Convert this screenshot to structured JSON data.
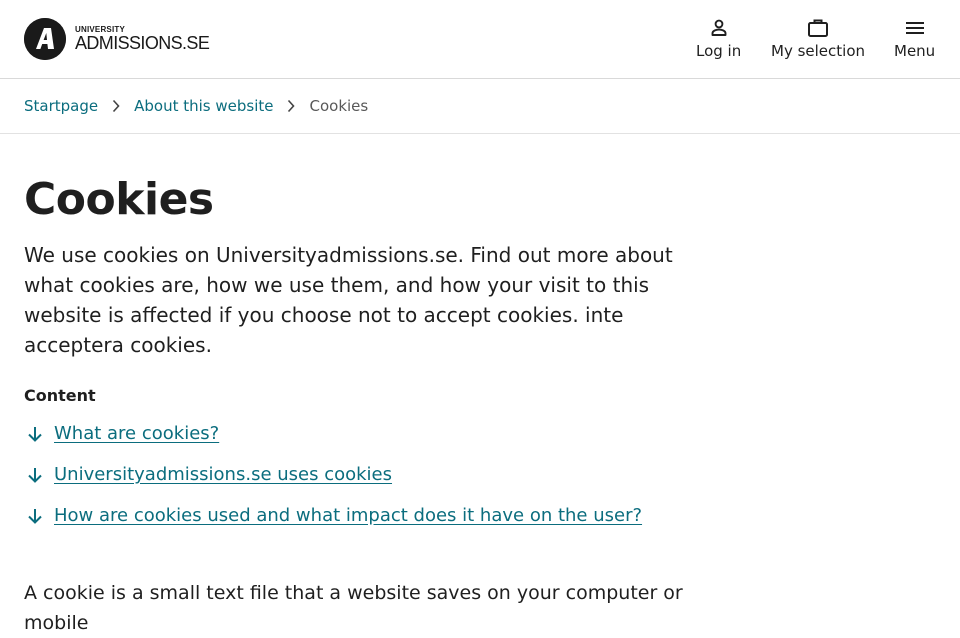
{
  "header": {
    "logo_small": "UNIVERSITY",
    "logo_big": "ADMISSIONS.SE",
    "login_label": "Log in",
    "selection_label": "My selection",
    "menu_label": "Menu"
  },
  "breadcrumb": {
    "items": [
      {
        "label": "Startpage"
      },
      {
        "label": "About this website"
      }
    ],
    "current": "Cookies"
  },
  "main": {
    "title": "Cookies",
    "intro": "We use cookies on Universityadmissions.se. Find out more about what cookies are, how we use them, and how your visit to this website is affected if you choose not to accept cookies. inte acceptera cookies.",
    "toc_heading": "Content",
    "toc": [
      {
        "label": "What are cookies?"
      },
      {
        "label": "Universityadmissions.se uses cookies"
      },
      {
        "label": "How are cookies used and what impact does it have on the user?"
      }
    ],
    "body": "A cookie is a small text file that a website saves on your computer or mobile"
  },
  "colors": {
    "link": "#0b6d7e",
    "text": "#1f1f1f",
    "muted": "#595959",
    "border": "#d9d9d9"
  },
  "icons": {
    "login": "person-icon",
    "selection": "briefcase-icon",
    "menu": "hamburger-menu-icon",
    "breadcrumb_separator": "chevron-right-icon",
    "toc_item": "arrow-down-icon"
  }
}
